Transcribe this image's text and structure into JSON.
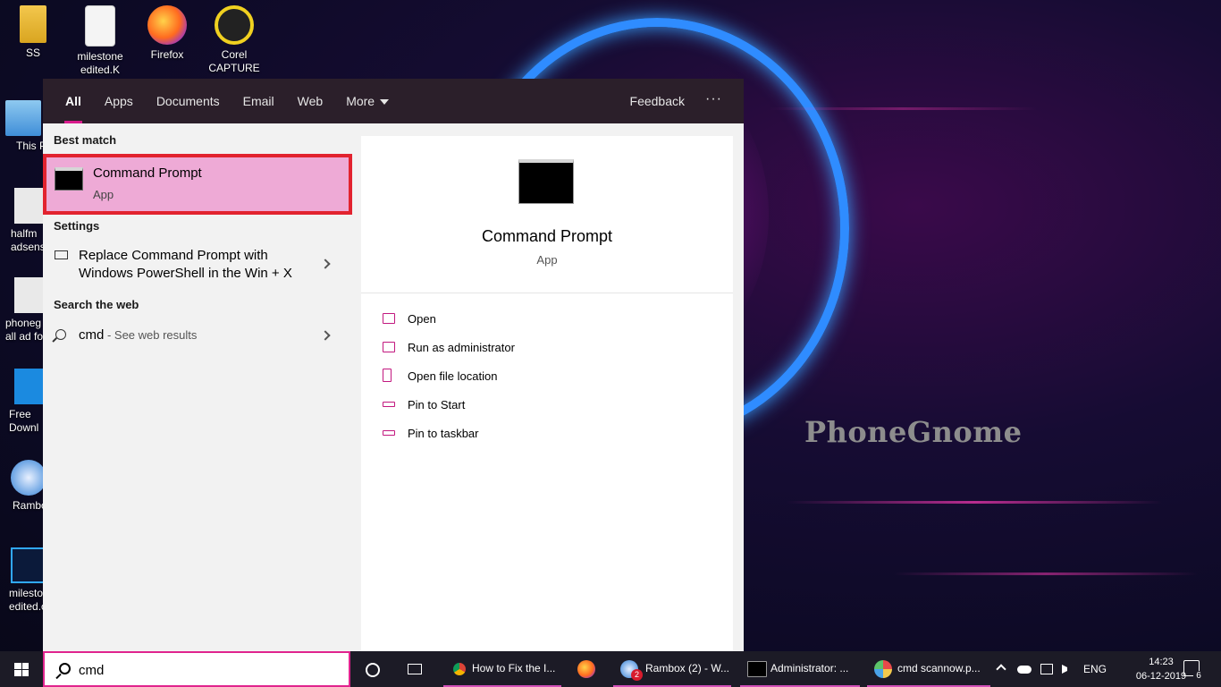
{
  "desktop": {
    "top_icons": [
      {
        "label": "SS"
      },
      {
        "label": "milestone edited.K"
      },
      {
        "label": "Firefox"
      },
      {
        "label": "Corel CAPTURE ..."
      }
    ],
    "left_icons": [
      {
        "label": "This P"
      },
      {
        "label": "halfm adsens"
      },
      {
        "label": "phoneg all ad fo"
      },
      {
        "label": "Free Downl"
      },
      {
        "label": "Rambo"
      },
      {
        "label": "milesto edited.c"
      }
    ],
    "watermark": "PhoneGnome"
  },
  "search_panel": {
    "tabs": [
      {
        "label": "All",
        "active": true
      },
      {
        "label": "Apps"
      },
      {
        "label": "Documents"
      },
      {
        "label": "Email"
      },
      {
        "label": "Web"
      },
      {
        "label": "More"
      }
    ],
    "feedback_label": "Feedback",
    "more_options_label": "···",
    "best_match": {
      "heading": "Best match",
      "title": "Command Prompt",
      "subtitle": "App"
    },
    "settings": {
      "heading": "Settings",
      "item_line1": "Replace Command Prompt with",
      "item_line2": "Windows PowerShell in the Win + X"
    },
    "web": {
      "heading": "Search the web",
      "query": "cmd",
      "hint": " - See web results"
    },
    "preview": {
      "title": "Command Prompt",
      "subtitle": "App",
      "actions": [
        {
          "label": "Open",
          "icon": "open-icon"
        },
        {
          "label": "Run as administrator",
          "icon": "shield-icon"
        },
        {
          "label": "Open file location",
          "icon": "file-location-icon"
        },
        {
          "label": "Pin to Start",
          "icon": "pin-icon"
        },
        {
          "label": "Pin to taskbar",
          "icon": "pin-icon"
        }
      ]
    }
  },
  "taskbar": {
    "search_value": "cmd",
    "tasks": [
      {
        "label": "How to Fix the I...",
        "icon": "chrome-icon",
        "color": "#e8b12a"
      },
      {
        "label": "",
        "icon": "firefox-icon",
        "color": "#ff7a1f"
      },
      {
        "label": "Rambox (2) - W...",
        "icon": "rambox-icon",
        "color": "#2f7fd6",
        "badge": "2"
      },
      {
        "label": "Administrator: ...",
        "icon": "terminal-icon",
        "color": "#333333"
      },
      {
        "label": "cmd scannow.p...",
        "icon": "paint-icon",
        "color": "#6aa7e0"
      }
    ],
    "language": "ENG",
    "time": "14:23",
    "date": "06-12-2019",
    "notification_count": "6"
  },
  "colors": {
    "accent": "#d81b8c",
    "highlight_bg": "#eeaad6",
    "highlight_border": "#e2232f",
    "panel_header": "#2b1f2a",
    "taskbar": "#1c1b26"
  }
}
